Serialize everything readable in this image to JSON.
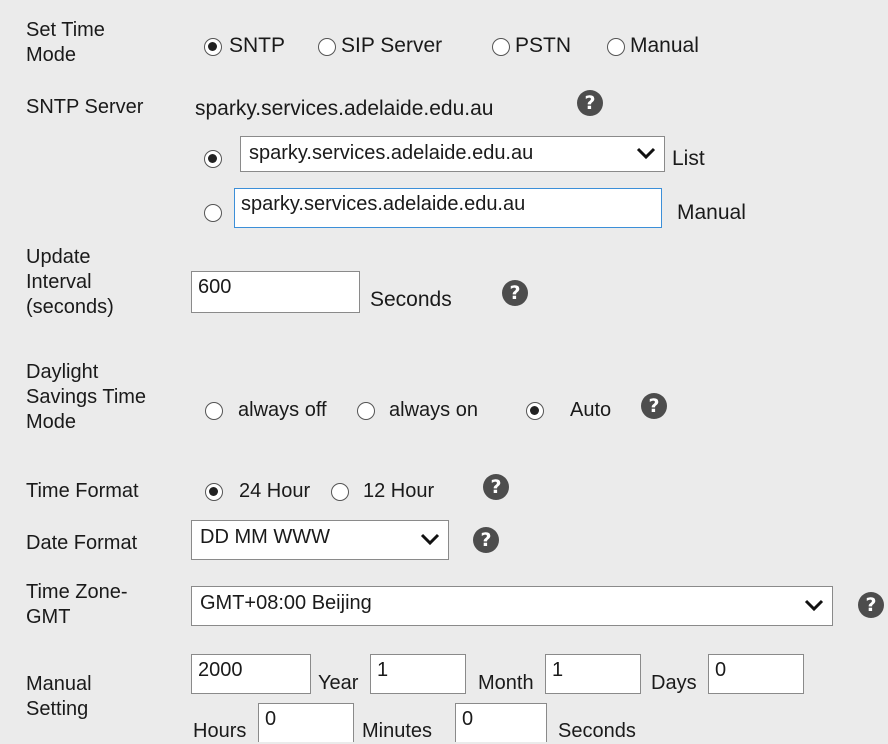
{
  "set_time_mode": {
    "label_line1": "Set Time",
    "label_line2": "Mode",
    "options": [
      "SNTP",
      "SIP Server",
      "PSTN",
      "Manual"
    ],
    "selected": "SNTP"
  },
  "sntp_server": {
    "label": "SNTP Server",
    "current": "sparky.services.adelaide.edu.au",
    "list_value": "sparky.services.adelaide.edu.au",
    "list_label": "List",
    "manual_value": "sparky.services.adelaide.edu.au",
    "manual_label": "Manual",
    "mode_selected": "List"
  },
  "update_interval": {
    "label_line1": "Update",
    "label_line2": "Interval",
    "label_line3": "(seconds)",
    "value": "600",
    "unit": "Seconds"
  },
  "dst_mode": {
    "label_line1": "Daylight",
    "label_line2": "Savings Time",
    "label_line3": "Mode",
    "options": [
      "always off",
      "always on",
      "Auto"
    ],
    "selected": "Auto"
  },
  "time_format": {
    "label": "Time Format",
    "options": [
      "24 Hour",
      "12 Hour"
    ],
    "selected": "24 Hour"
  },
  "date_format": {
    "label": "Date Format",
    "value": "DD MM WWW"
  },
  "time_zone": {
    "label_line1": "Time Zone-",
    "label_line2": "GMT",
    "value": "GMT+08:00 Beijing"
  },
  "manual_setting": {
    "label_line1": "Manual",
    "label_line2": "Setting",
    "year_value": "2000",
    "year_label": "Year",
    "month_value": "1",
    "month_label": "Month",
    "days_value": "1",
    "days_label": "Days",
    "hours_value": "0",
    "hours_label": "Hours",
    "minutes_value": "0",
    "minutes_label": "Minutes",
    "seconds_value": "0",
    "seconds_label": "Seconds"
  },
  "icons": {
    "help": "help-question-icon",
    "dropdown": "chevron-down-icon"
  },
  "colors": {
    "background": "#ebebeb",
    "focus_border": "#3c8fd8",
    "help_icon": "#4d4d4d"
  }
}
